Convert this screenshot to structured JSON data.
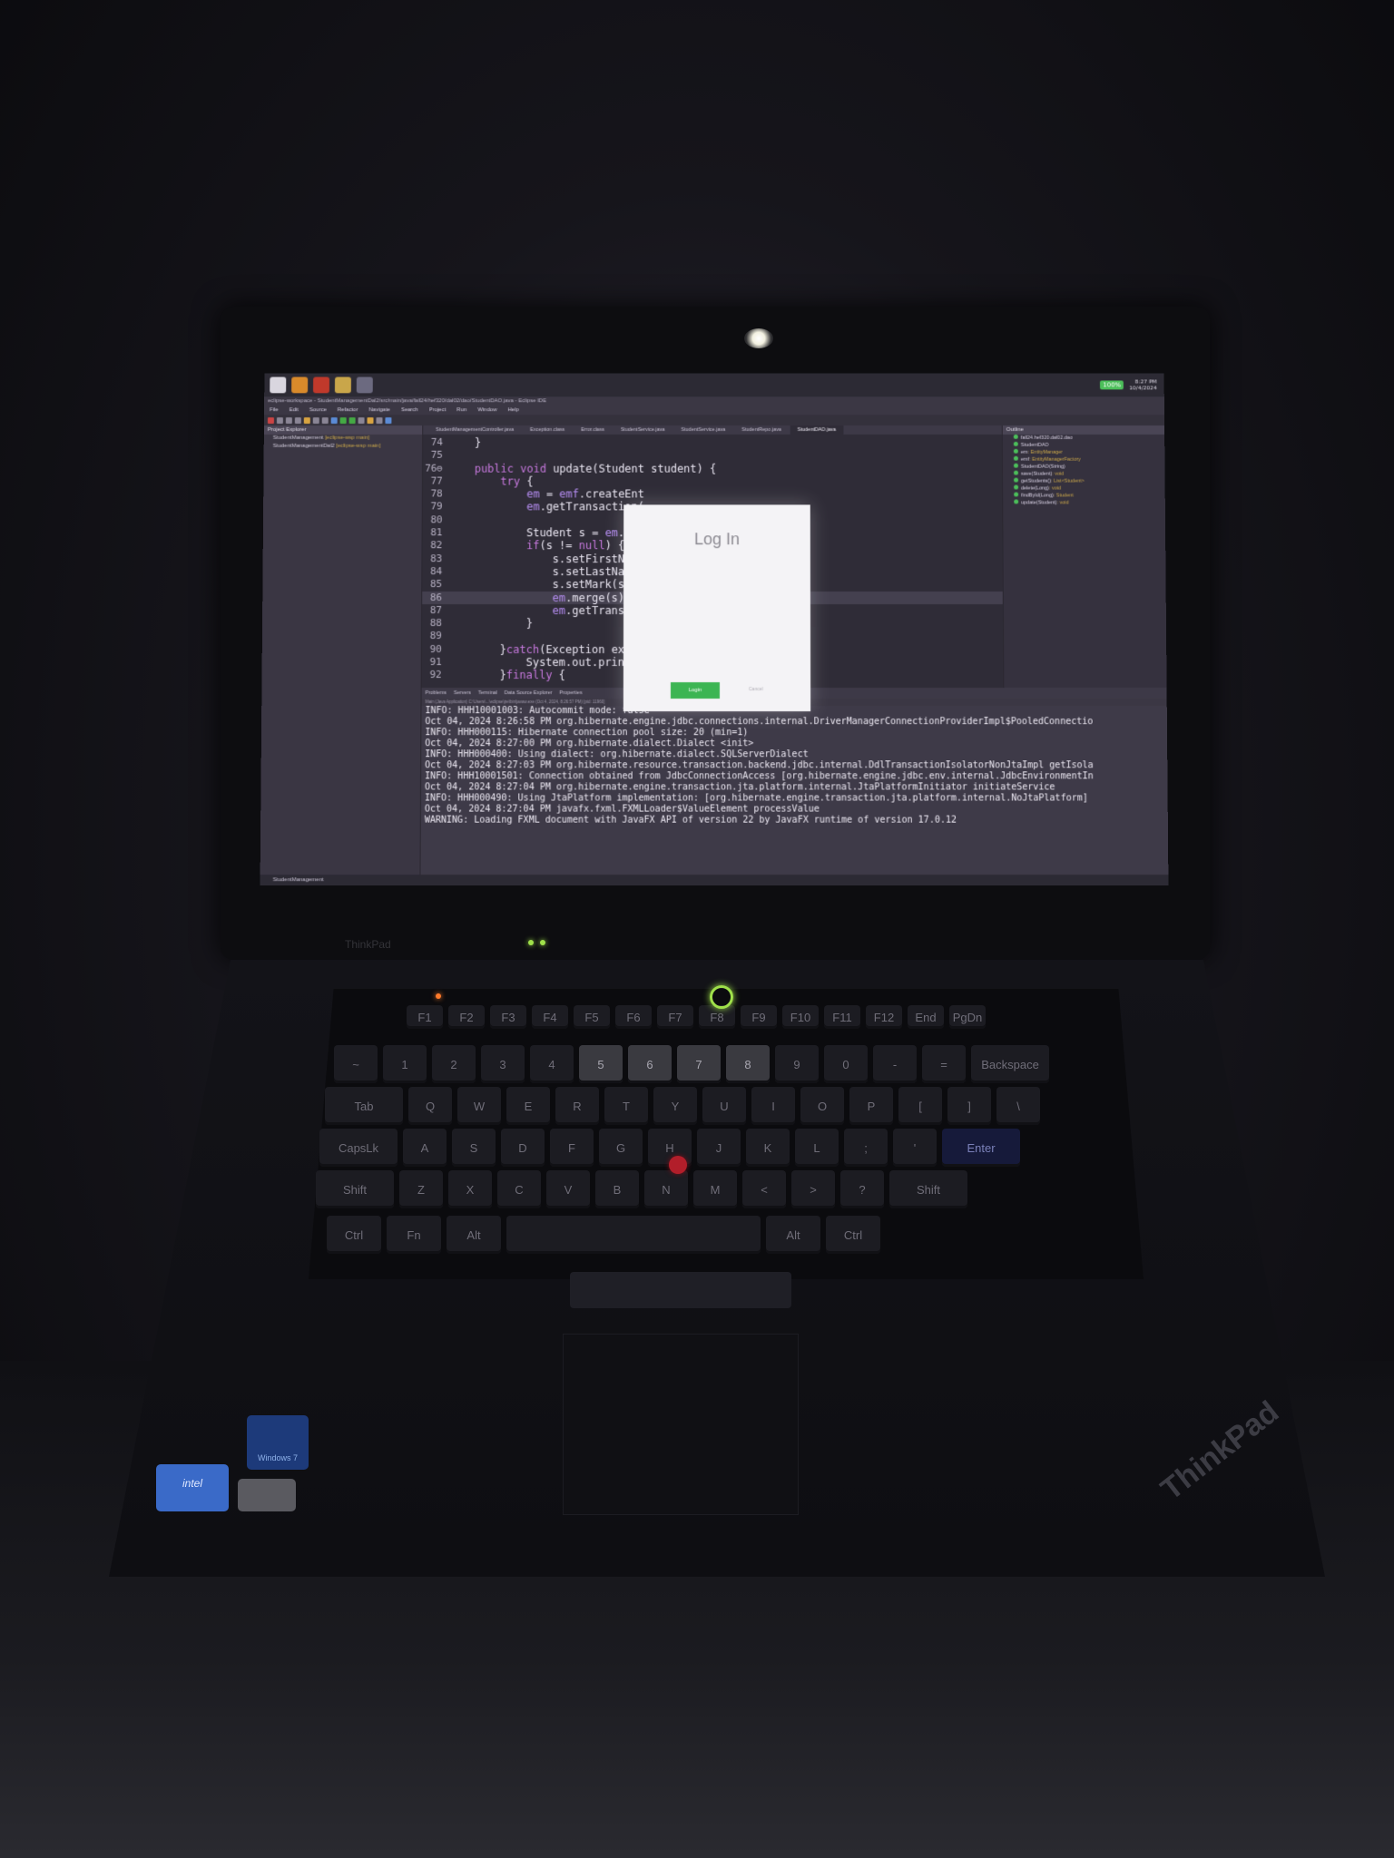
{
  "taskbar": {
    "battery_badge": "100%",
    "clock_time": "8:27 PM",
    "clock_date": "10/4/2024"
  },
  "window": {
    "title": "eclipse-workspace - StudentManagementDal2/src/main/java/fall24/hef320/dal02/dao/StudentDAO.java - Eclipse IDE"
  },
  "menu": [
    "File",
    "Edit",
    "Source",
    "Refactor",
    "Navigate",
    "Search",
    "Project",
    "Run",
    "Window",
    "Help"
  ],
  "project_explorer": {
    "tab_label": "Project Explorer",
    "items": [
      {
        "name": "StudentManagement",
        "tag": "[eclipse-wsp main]"
      },
      {
        "name": "StudentManagementDal2",
        "tag": "[eclipse-wsp main]"
      }
    ]
  },
  "editor": {
    "tabs": [
      "StudentManagementController.java",
      "Exception.class",
      "Error.class",
      "StudentService.java",
      "StudentService.java",
      "StudentRepo.java",
      "StudentDAO.java"
    ],
    "active_tab": "StudentDAO.java",
    "lines": [
      {
        "n": "74",
        "code": "    }"
      },
      {
        "n": "75",
        "code": ""
      },
      {
        "n": "76⊖",
        "code": "    public void update(Student student) {"
      },
      {
        "n": "77",
        "code": "        try {"
      },
      {
        "n": "78",
        "code": "            em = emf.createEnt"
      },
      {
        "n": "79",
        "code": "            em.getTransaction("
      },
      {
        "n": "80",
        "code": ""
      },
      {
        "n": "81",
        "code": "            Student s = em.fin                   ));"
      },
      {
        "n": "82",
        "code": "            if(s != null) {"
      },
      {
        "n": "83",
        "code": "                s.setFirstName"
      },
      {
        "n": "84",
        "code": "                s.setLastName("
      },
      {
        "n": "85",
        "code": "                s.setMark(stud"
      },
      {
        "n": "86",
        "code": "                em.merge(s);"
      },
      {
        "n": "87",
        "code": "                em.getTransact"
      },
      {
        "n": "88",
        "code": "            }"
      },
      {
        "n": "89",
        "code": ""
      },
      {
        "n": "90",
        "code": "        }catch(Exception ex) {"
      },
      {
        "n": "91",
        "code": "            System.out.printl"
      },
      {
        "n": "92",
        "code": "        }finally {"
      }
    ]
  },
  "outline": {
    "tab_label": "Outline",
    "items": [
      {
        "name": "fall24.hef320.dal02.dao",
        "type": ""
      },
      {
        "name": "StudentDAO",
        "type": ""
      },
      {
        "name": "em",
        "type": ": EntityManager"
      },
      {
        "name": "emf",
        "type": ": EntityManagerFactory"
      },
      {
        "name": "StudentDAO(String)",
        "type": ""
      },
      {
        "name": "save(Student)",
        "type": ": void"
      },
      {
        "name": "getStudents()",
        "type": ": List<Student>"
      },
      {
        "name": "delete(Long)",
        "type": ": void"
      },
      {
        "name": "findById(Long)",
        "type": ": Student"
      },
      {
        "name": "update(Student)",
        "type": ": void"
      }
    ]
  },
  "console": {
    "tabs": [
      "Problems",
      "Servers",
      "Terminal",
      "Data Source Explorer",
      "Properties"
    ],
    "path": "Main (Java Application) C:\\Users\\...\\eclipse\\jre\\bin\\javaw.exe (Oct 4, 2024, 8:26:57 PM) [pid: 11960]",
    "lines": [
      "INFO: HHH10001003: Autocommit mode: false",
      "Oct 04, 2024 8:26:58 PM org.hibernate.engine.jdbc.connections.internal.DriverManagerConnectionProviderImpl$PooledConnectio",
      "INFO: HHH000115: Hibernate connection pool size: 20 (min=1)",
      "Oct 04, 2024 8:27:00 PM org.hibernate.dialect.Dialect <init>",
      "INFO: HHH000400: Using dialect: org.hibernate.dialect.SQLServerDialect",
      "Oct 04, 2024 8:27:03 PM org.hibernate.resource.transaction.backend.jdbc.internal.DdlTransactionIsolatorNonJtaImpl getIsola",
      "INFO: HHH10001501: Connection obtained from JdbcConnectionAccess [org.hibernate.engine.jdbc.env.internal.JdbcEnvironmentIn",
      "Oct 04, 2024 8:27:04 PM org.hibernate.engine.transaction.jta.platform.internal.JtaPlatformInitiator initiateService",
      "INFO: HHH000490: Using JtaPlatform implementation: [org.hibernate.engine.transaction.jta.platform.internal.NoJtaPlatform]",
      "Oct 04, 2024 8:27:04 PM javafx.fxml.FXMLLoader$ValueElement processValue",
      "WARNING: Loading FXML document with JavaFX API of version 22 by JavaFX runtime of version 17.0.12"
    ]
  },
  "statusbar": {
    "text": "StudentManagement"
  },
  "login_dialog": {
    "title": "Log In",
    "login_button": "Login",
    "secondary_link": "Cancel"
  },
  "laptop": {
    "bezel_brand": "ThinkPad",
    "base_logo": "ThinkPad",
    "sticker_windows": "Windows 7",
    "sticker_intel": "intel"
  },
  "keyboard": {
    "row1": [
      "F1",
      "F2",
      "F3",
      "F4",
      "F5",
      "F6",
      "F7",
      "F8",
      "F9",
      "F10",
      "F11",
      "F12",
      "End",
      "PgDn"
    ],
    "row2": [
      "~",
      "1",
      "2",
      "3",
      "4",
      "5",
      "6",
      "7",
      "8",
      "9",
      "0",
      "-",
      "=",
      "Backspace"
    ],
    "row3": [
      "Tab",
      "Q",
      "W",
      "E",
      "R",
      "T",
      "Y",
      "U",
      "I",
      "O",
      "P",
      "[",
      "]",
      "\\"
    ],
    "row4": [
      "CapsLk",
      "A",
      "S",
      "D",
      "F",
      "G",
      "H",
      "J",
      "K",
      "L",
      ";",
      "'",
      "Enter"
    ],
    "row5": [
      "Shift",
      "Z",
      "X",
      "C",
      "V",
      "B",
      "N",
      "M",
      "<",
      ">",
      "?",
      "Shift"
    ],
    "row6": [
      "Ctrl",
      "Fn",
      "Alt",
      "",
      "Alt",
      "Ctrl"
    ]
  },
  "colors": {
    "login_button": "#3cb553",
    "editor_bg": "#2f2c37",
    "keyword": "#c678dd",
    "power_led": "#9fe04a",
    "trackpoint": "#b21e2a"
  }
}
